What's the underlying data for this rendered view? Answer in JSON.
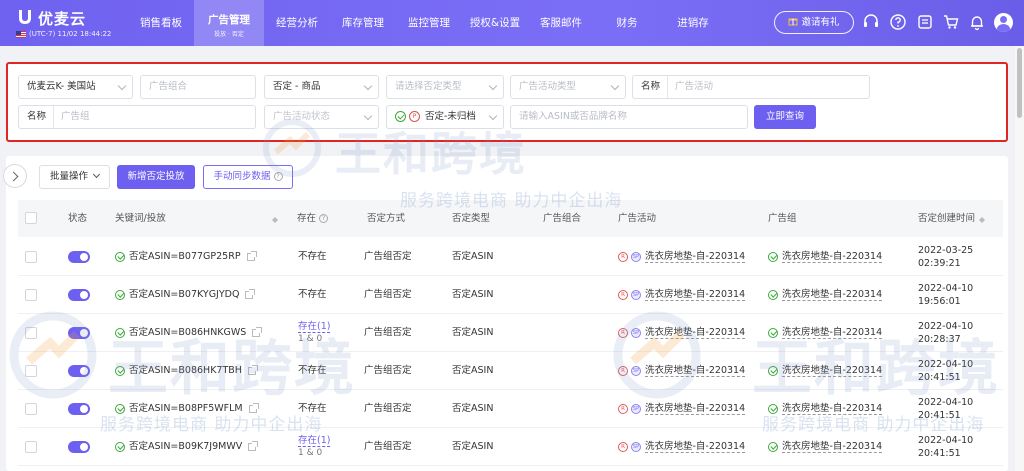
{
  "brand": {
    "name": "优麦云",
    "timezone": "(UTC-7) 11/02 18:44:22"
  },
  "nav": {
    "items": [
      {
        "label": "销售看板"
      },
      {
        "label": "广告管理",
        "sub": "投放 · 否定",
        "active": true
      },
      {
        "label": "经营分析"
      },
      {
        "label": "库存管理"
      },
      {
        "label": "监控管理"
      },
      {
        "label": "授权&设置"
      },
      {
        "label": "客服邮件"
      },
      {
        "label": "财务"
      },
      {
        "label": "进销存"
      }
    ],
    "invite_label": "邀请有礼"
  },
  "filters": {
    "store": "优麦云K- 美国站",
    "ad_group_combo_placeholder": "广告组合",
    "negate_scope": "否定 - 商品",
    "negate_type_placeholder": "请选择否定类型",
    "campaign_type_placeholder": "广告活动类型",
    "name_label_1": "名称",
    "campaign_placeholder": "广告活动",
    "name_label_2": "名称",
    "ad_group_placeholder": "广告组",
    "campaign_status_placeholder": "广告活动状态",
    "archive_status": "否定-未归档",
    "archive_badge": "P",
    "asin_placeholder": "请输入ASIN或否品牌名称",
    "query_button": "立即查询"
  },
  "toolbar": {
    "batch_label": "批量操作",
    "add_negative_label": "新增否定投放",
    "sync_label": "手动同步数据"
  },
  "table": {
    "headers": {
      "status": "状态",
      "keyword": "关键词/投放",
      "exists": "存在",
      "negate_method": "否定方式",
      "negate_type": "否定类型",
      "ad_portfolio": "广告组合",
      "campaign": "广告活动",
      "ad_group": "广告组",
      "created": "否定创建时间"
    },
    "badge_red": "R",
    "badge_sp": "SP",
    "rows": [
      {
        "keyword": "否定ASIN=B077GP25RP",
        "exists": "不存在",
        "method": "广告组否定",
        "type": "否定ASIN",
        "campaign": "洗衣房地垫-自-220314",
        "ad_group": "洗衣房地垫-自-220314",
        "date": "2022-03-25",
        "time": "02:39:21"
      },
      {
        "keyword": "否定ASIN=B07KYGJYDQ",
        "exists": "不存在",
        "method": "广告组否定",
        "type": "否定ASIN",
        "campaign": "洗衣房地垫-自-220314",
        "ad_group": "洗衣房地垫-自-220314",
        "date": "2022-04-10",
        "time": "19:56:01"
      },
      {
        "keyword": "否定ASIN=B086HNKGWS",
        "exists": "存在(1)",
        "exists_sub": "1 & 0",
        "method": "广告组否定",
        "type": "否定ASIN",
        "campaign": "洗衣房地垫-自-220314",
        "ad_group": "洗衣房地垫-自-220314",
        "date": "2022-04-10",
        "time": "20:28:37"
      },
      {
        "keyword": "否定ASIN=B086HK7TBH",
        "exists": "不存在",
        "method": "广告组否定",
        "type": "否定ASIN",
        "campaign": "洗衣房地垫-自-220314",
        "ad_group": "洗衣房地垫-自-220314",
        "date": "2022-04-10",
        "time": "20:41:51"
      },
      {
        "keyword": "否定ASIN=B08PF5WFLM",
        "exists": "不存在",
        "method": "广告组否定",
        "type": "否定ASIN",
        "campaign": "洗衣房地垫-自-220314",
        "ad_group": "洗衣房地垫-自-220314",
        "date": "2022-04-10",
        "time": "20:41:51"
      },
      {
        "keyword": "否定ASIN=B09K7J9MWV",
        "exists": "存在(1)",
        "exists_sub": "1 & 0",
        "method": "广告组否定",
        "type": "否定ASIN",
        "campaign": "洗衣房地垫-自-220314",
        "ad_group": "洗衣房地垫-自-220314",
        "date": "2022-04-10",
        "time": "20:41:51"
      }
    ]
  },
  "watermark": {
    "title": "王和跨境",
    "slogan": "服务跨境电商 助力中企出海"
  },
  "colors": {
    "primary": "#6d5ff0",
    "nav_bg": "#7b6ef6",
    "highlight_border": "#e02525",
    "success": "#3aaa3a"
  }
}
